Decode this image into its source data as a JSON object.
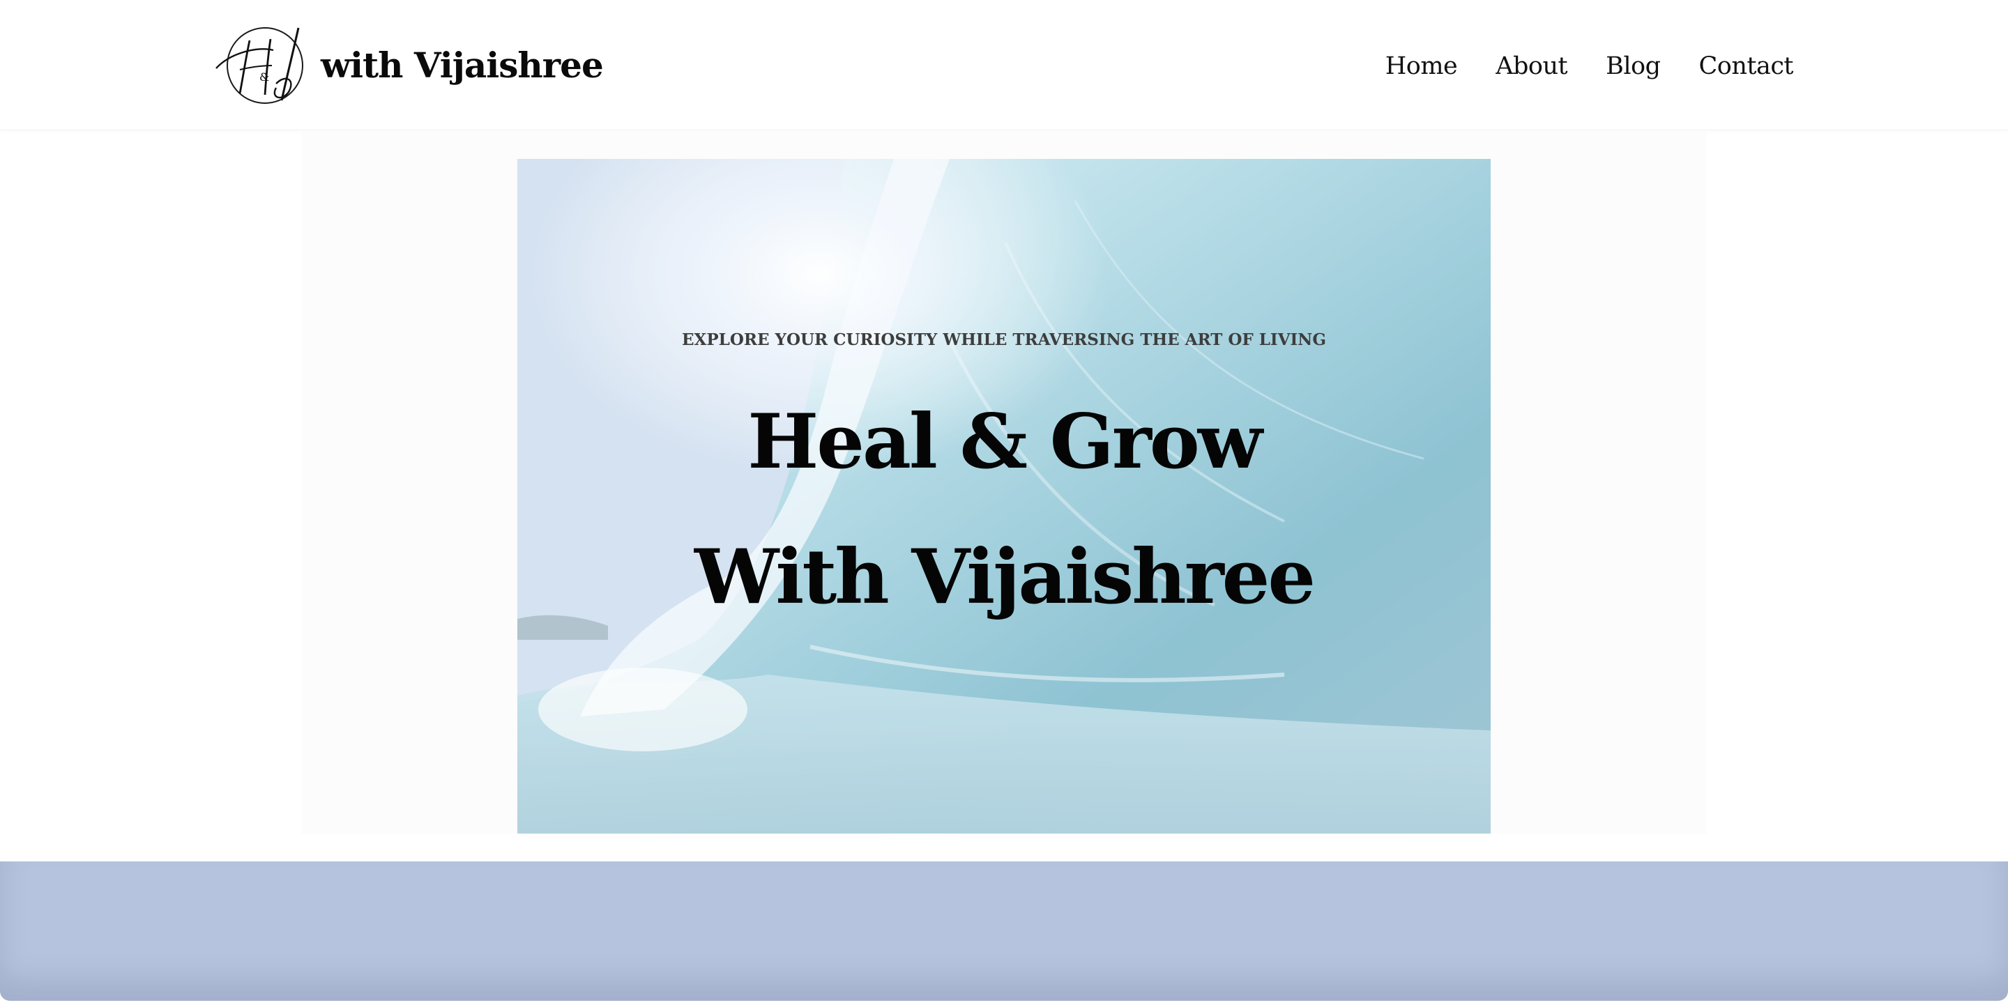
{
  "header": {
    "site_title": "with Vijaishree",
    "logo_icon": "hg-monogram-logo-icon",
    "nav": [
      {
        "label": "Home"
      },
      {
        "label": "About"
      },
      {
        "label": "Blog"
      },
      {
        "label": "Contact"
      }
    ]
  },
  "hero": {
    "kicker": "EXPLORE YOUR CURIOSITY WHILE TRAVERSING THE ART OF LIVING",
    "title_line1": "Heal & Grow",
    "title_line2": "With Vijaishree",
    "background_image": "ocean-wave-photo"
  },
  "colors": {
    "background": "#ffffff",
    "text": "#050505",
    "band": "#b6c3de"
  }
}
